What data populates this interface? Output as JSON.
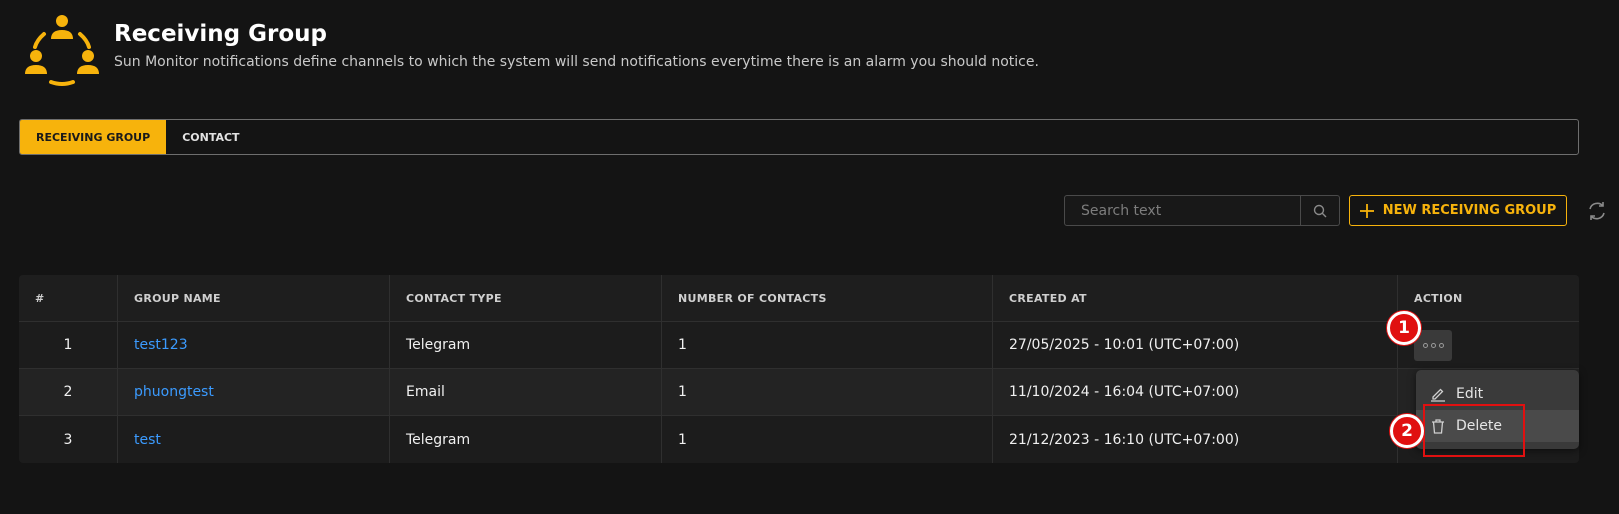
{
  "header": {
    "title": "Receiving Group",
    "subtitle": "Sun Monitor notifications define channels to which the system will send notifications everytime there is an alarm you should notice.",
    "icon": "receiving-group-people-icon",
    "accent_color": "#f7b30c"
  },
  "tabs": [
    {
      "label": "RECEIVING GROUP",
      "active": true
    },
    {
      "label": "CONTACT",
      "active": false
    }
  ],
  "toolbar": {
    "search_placeholder": "Search text",
    "new_button_label": "NEW RECEIVING GROUP"
  },
  "table": {
    "columns": [
      "#",
      "GROUP NAME",
      "CONTACT TYPE",
      "NUMBER OF CONTACTS",
      "CREATED AT",
      "ACTION"
    ],
    "rows": [
      {
        "index": "1",
        "group_name": "test123",
        "contact_type": "Telegram",
        "contacts": "1",
        "created_at": "27/05/2025 - 10:01 (UTC+07:00)"
      },
      {
        "index": "2",
        "group_name": "phuongtest",
        "contact_type": "Email",
        "contacts": "1",
        "created_at": "11/10/2024 - 16:04 (UTC+07:00)"
      },
      {
        "index": "3",
        "group_name": "test",
        "contact_type": "Telegram",
        "contacts": "1",
        "created_at": "21/12/2023 - 16:10 (UTC+07:00)"
      }
    ]
  },
  "action_menu": {
    "edit_label": "Edit",
    "delete_label": "Delete"
  },
  "annotations": {
    "step1": "1",
    "step2": "2",
    "highlight_color": "#e01010"
  }
}
